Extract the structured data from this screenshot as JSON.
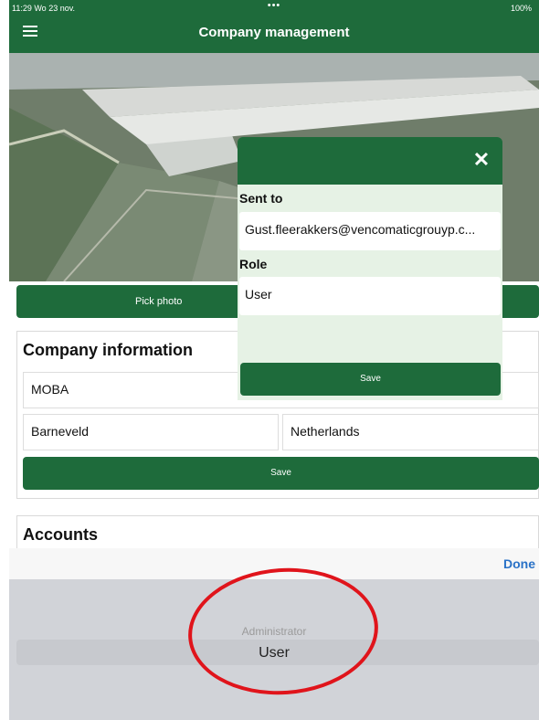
{
  "status_bar": {
    "time": "11:29  Wo 23 nov.",
    "dots": "•••",
    "battery": "100%"
  },
  "header": {
    "title": "Company management",
    "menu_icon": "hamburger-menu-icon"
  },
  "photo": {
    "pick_label": "Pick photo"
  },
  "company": {
    "title": "Company information",
    "name": "MOBA",
    "city": "Barneveld",
    "country": "Netherlands",
    "save_label": "Save"
  },
  "accounts": {
    "title": "Accounts"
  },
  "invite_dialog": {
    "close_icon": "close-icon",
    "sent_to_label": "Sent to",
    "sent_to_value": "Gust.fleerakkers@vencomaticgrouyp.c...",
    "role_label": "Role",
    "role_value": "User",
    "save_label": "Save"
  },
  "picker": {
    "done_label": "Done",
    "options": [
      "Administrator",
      "User"
    ],
    "selected": "User"
  },
  "colors": {
    "primary": "#1e6b3b",
    "dialog_bg": "#e6f2e5",
    "link": "#2a72c7",
    "annotation": "#e0141b"
  }
}
